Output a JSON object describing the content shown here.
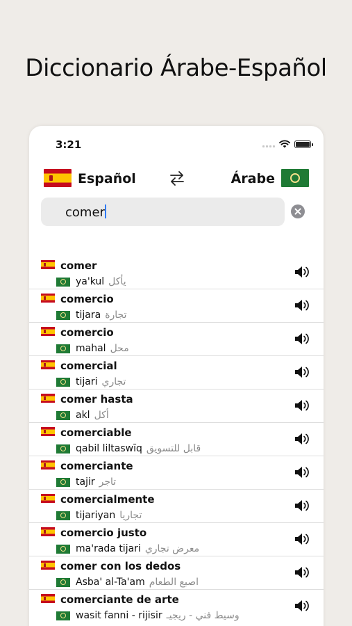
{
  "headline": "Diccionario Árabe-Español",
  "status_bar": {
    "time": "3:21"
  },
  "language_bar": {
    "source_label": "Español",
    "target_label": "Árabe"
  },
  "search": {
    "value": "comer"
  },
  "results": [
    {
      "term": "comer",
      "transliteration": "ya'kul",
      "arabic": "يأكل"
    },
    {
      "term": "comercio",
      "transliteration": "tijara",
      "arabic": "تجارة"
    },
    {
      "term": "comercio",
      "transliteration": "mahal",
      "arabic": "محل"
    },
    {
      "term": "comercial",
      "transliteration": "tijari",
      "arabic": "تجاري"
    },
    {
      "term": "comer hasta",
      "transliteration": "akl",
      "arabic": "أكل"
    },
    {
      "term": "comerciable",
      "transliteration": "qabil liltaswīq",
      "arabic": "قابل للتسويق"
    },
    {
      "term": "comerciante",
      "transliteration": "tajir",
      "arabic": "تاجر"
    },
    {
      "term": "comercialmente",
      "transliteration": "tijariyan",
      "arabic": "تجاريا"
    },
    {
      "term": "comercio justo",
      "transliteration": "ma'rada tijari",
      "arabic": "معرض تجاري"
    },
    {
      "term": "comer con los dedos",
      "transliteration": "Asba' al-Ta'am",
      "arabic": "اصبع الطعام"
    },
    {
      "term": "comerciante de arte",
      "transliteration": "wasit fanni - rijisir",
      "arabic": "وسيط فني - ريجيـ"
    }
  ]
}
